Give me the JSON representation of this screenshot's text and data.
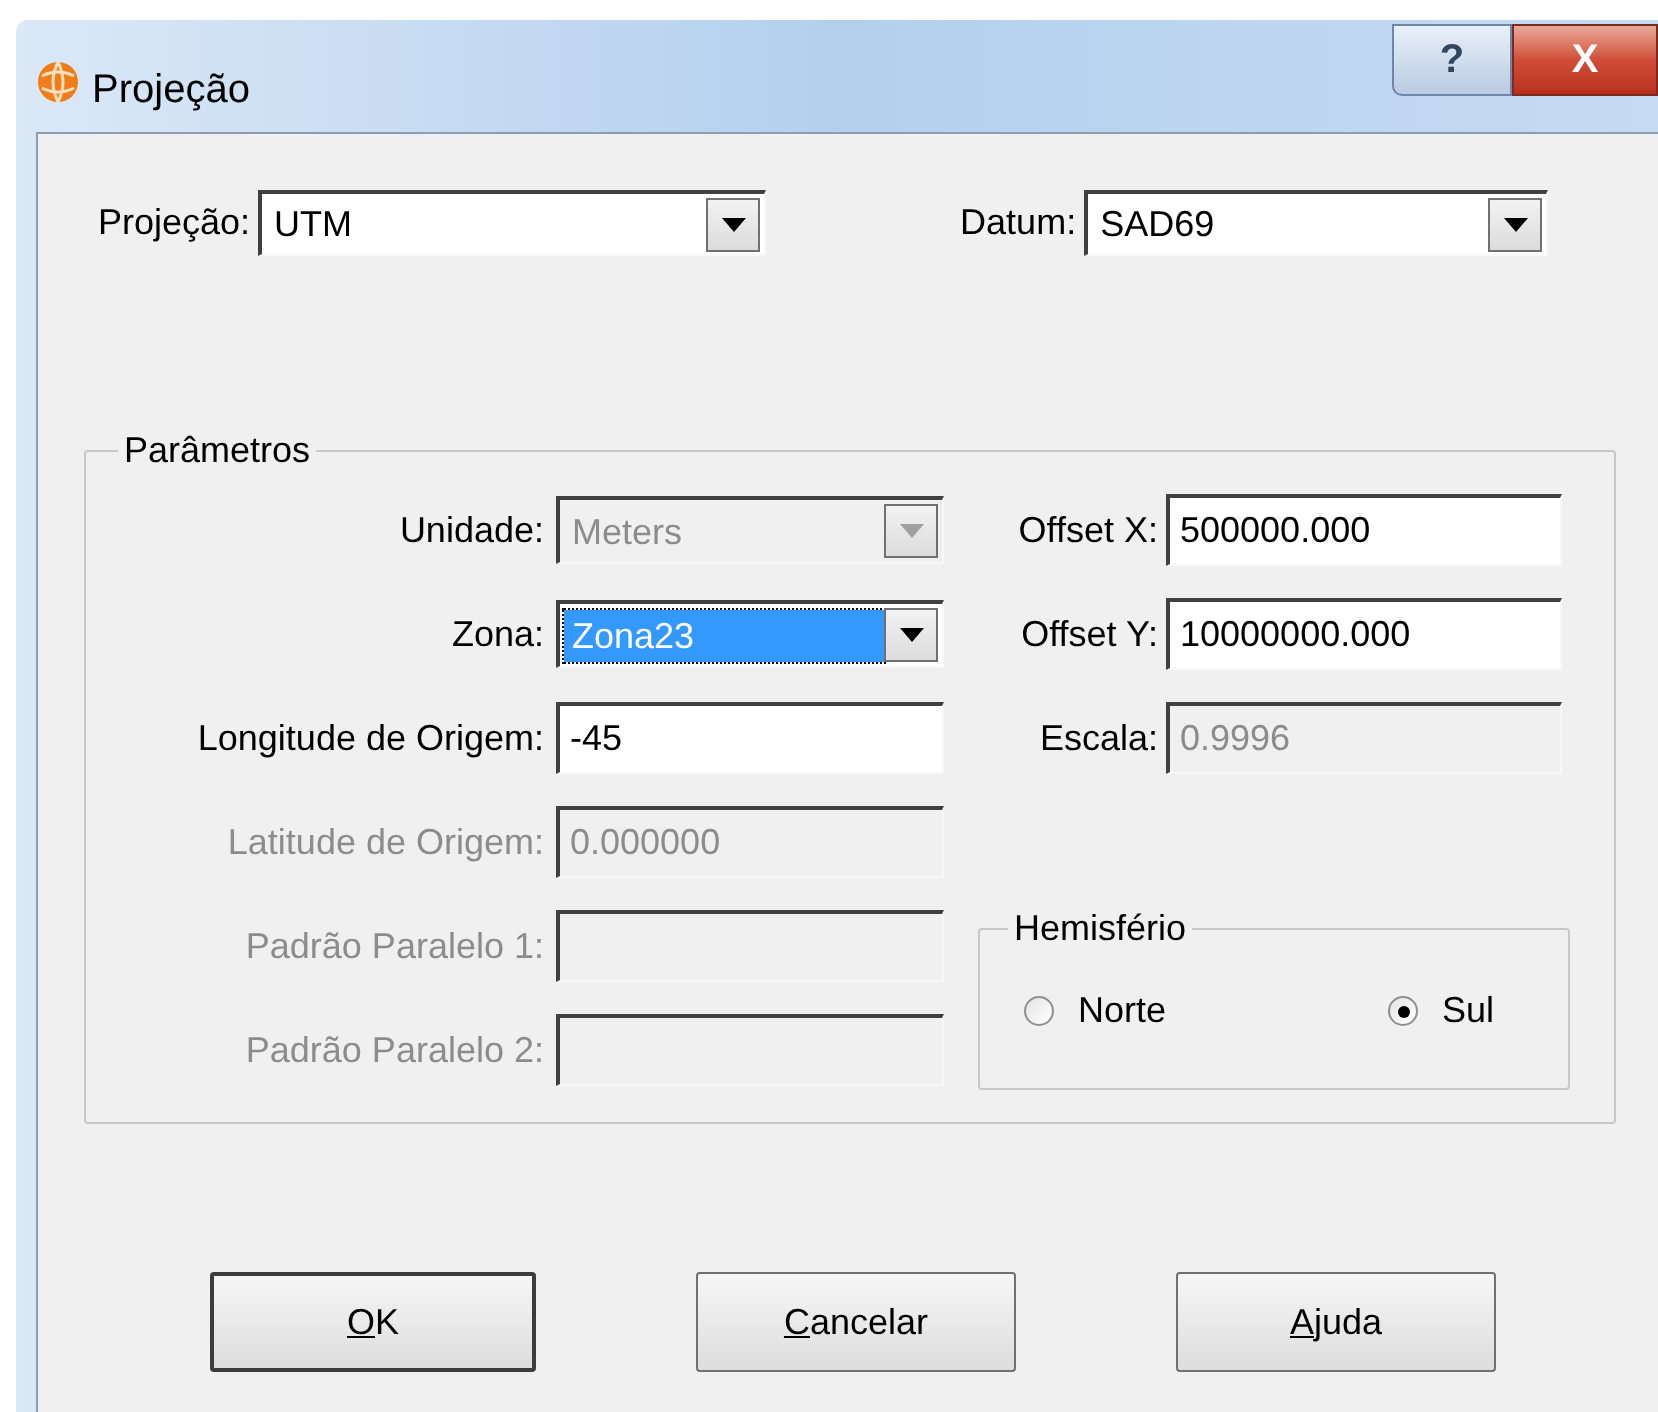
{
  "window": {
    "title": "Projeção",
    "help_button": "?",
    "close_button": "X"
  },
  "top_fields": [
    {
      "label": "Projeção:",
      "value": "UTM"
    },
    {
      "label": "Datum:",
      "value": "SAD69"
    }
  ],
  "parameters": {
    "title": "Parâmetros",
    "left_fields": [
      {
        "kind": "combo",
        "label": "Unidade:",
        "value": "Meters",
        "label_disabled": false,
        "disabled": true,
        "highlighted": false
      },
      {
        "kind": "combo",
        "label": "Zona:",
        "value": "Zona23",
        "label_disabled": false,
        "disabled": false,
        "highlighted": true
      },
      {
        "kind": "text",
        "label": "Longitude de Origem:",
        "value": "-45",
        "label_disabled": false,
        "disabled": false
      },
      {
        "kind": "text",
        "label": "Latitude de Origem:",
        "value": "0.000000",
        "label_disabled": true,
        "disabled": true
      },
      {
        "kind": "text",
        "label": "Padrão Paralelo 1:",
        "label_disabled": true,
        "disabled": true
      },
      {
        "kind": "text",
        "label": "Padrão Paralelo 2:",
        "label_disabled": true,
        "disabled": true
      }
    ],
    "right_fields": [
      {
        "label": "Offset X:",
        "value": "500000.000",
        "disabled": false
      },
      {
        "label": "Offset Y:",
        "value": "10000000.000",
        "disabled": false
      },
      {
        "label": "Escala:",
        "value": "0.9996",
        "disabled": true
      }
    ],
    "hemisphere": {
      "title": "Hemisfério",
      "options": [
        {
          "label": "Norte",
          "selected": false
        },
        {
          "label": "Sul",
          "selected": true
        }
      ]
    }
  },
  "buttons": [
    {
      "label": "OK",
      "first_letter_underlined": true,
      "default": true
    },
    {
      "label": "Cancelar",
      "first_letter_underlined": true,
      "default": false
    },
    {
      "label": "Ajuda",
      "first_letter_underlined": true,
      "default": false
    }
  ]
}
